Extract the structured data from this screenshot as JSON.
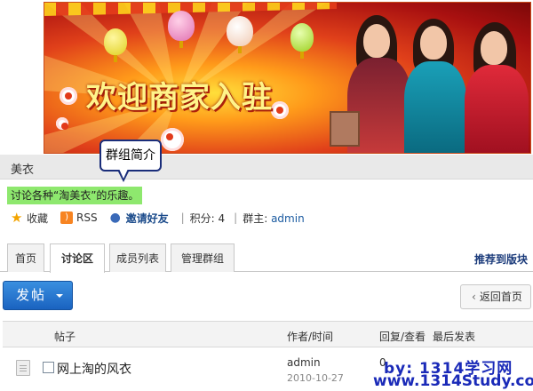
{
  "banner": {
    "headline": "欢迎商家入驻"
  },
  "group": {
    "name": "美衣",
    "callout": "群组简介",
    "description": "讨论各种“淘美衣”的乐趣。"
  },
  "actions": {
    "favorite": "收藏",
    "rss": "RSS",
    "invite": "邀请好友",
    "points": "积分: 4",
    "owner_label": "群主:",
    "owner": "admin"
  },
  "tabs": [
    "首页",
    "讨论区",
    "成员列表",
    "管理群组"
  ],
  "active_tab": "讨论区",
  "recommend": "推荐到版块",
  "post_button": "发帖",
  "back_button": "返回首页",
  "table": {
    "headers": {
      "topic": "帖子",
      "author": "作者/时间",
      "replies": "回复/查看",
      "last": "最后发表"
    },
    "rows": [
      {
        "title": "网上淘的风衣",
        "author": "admin",
        "date": "2010-10-27",
        "replies": "0"
      }
    ]
  },
  "watermark": {
    "line1": "by: 1314学习网",
    "line2": "www.1314Study.com"
  },
  "colors": {
    "post_button": "#1a63c0",
    "description_highlight": "#8ee86e",
    "callout_border": "#1a2d7a",
    "watermark": "#1a2ab8"
  }
}
